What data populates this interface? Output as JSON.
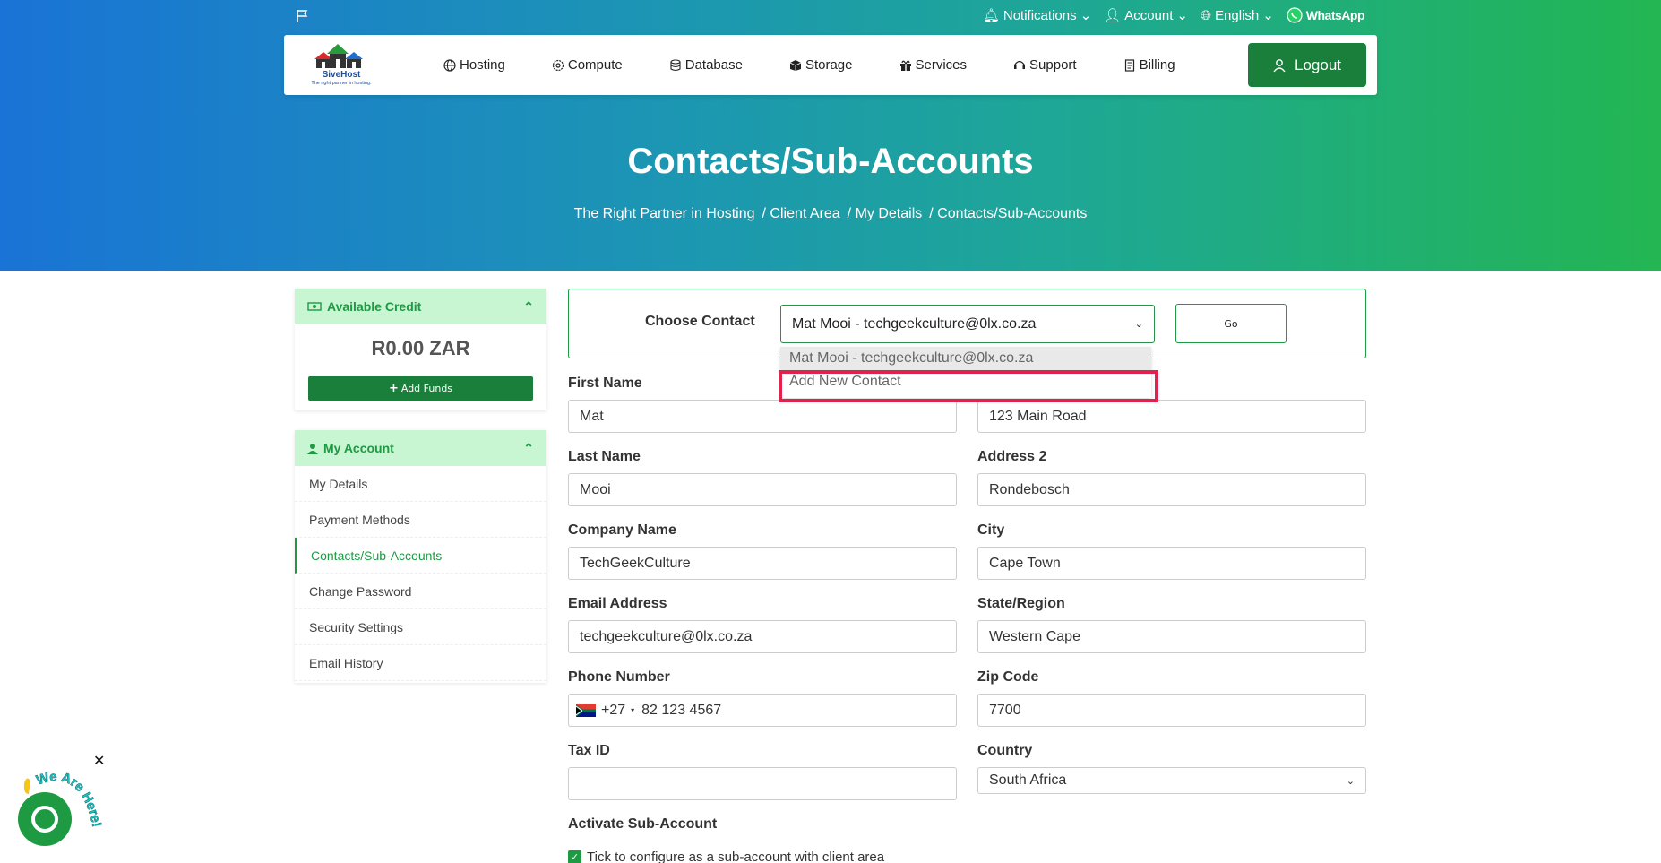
{
  "topbar": {
    "notifications": "Notifications",
    "account": "Account",
    "language": "English",
    "whatsapp": "WhatsApp"
  },
  "logo": {
    "name": "SiveHost",
    "tagline": "The right partner in hosting."
  },
  "nav": {
    "items": [
      "Hosting",
      "Compute",
      "Database",
      "Storage",
      "Services",
      "Support",
      "Billing"
    ],
    "logout": "Logout"
  },
  "page": {
    "title": "Contacts/Sub-Accounts",
    "breadcrumb": [
      "The Right Partner in Hosting",
      "/ Client Area",
      "/ My Details",
      "/ Contacts/Sub-Accounts"
    ]
  },
  "sidebar": {
    "credit": {
      "title": "Available Credit",
      "amount": "R0.00 ZAR",
      "add_funds": "Add Funds"
    },
    "account": {
      "title": "My Account",
      "items": [
        "My Details",
        "Payment Methods",
        "Contacts/Sub-Accounts",
        "Change Password",
        "Security Settings",
        "Email History"
      ]
    }
  },
  "choose": {
    "label": "Choose Contact",
    "selected": "Mat Mooi - techgeekculture@0lx.co.za",
    "options": [
      "Mat Mooi - techgeekculture@0lx.co.za",
      "Add New Contact"
    ],
    "go": "Go"
  },
  "form": {
    "first_name_label": "First Name",
    "first_name": "Mat",
    "last_name_label": "Last Name",
    "last_name": "Mooi",
    "company_label": "Company Name",
    "company": "TechGeekCulture",
    "email_label": "Email Address",
    "email": "techgeekculture@0lx.co.za",
    "phone_label": "Phone Number",
    "phone_code": "+27",
    "phone": "82 123 4567",
    "tax_label": "Tax ID",
    "tax": "",
    "address1": "123 Main Road",
    "address2_label": "Address 2",
    "address2": "Rondebosch",
    "city_label": "City",
    "city": "Cape Town",
    "state_label": "State/Region",
    "state": "Western Cape",
    "zip_label": "Zip Code",
    "zip": "7700",
    "country_label": "Country",
    "country": "South Africa",
    "subaccount_label": "Activate Sub-Account",
    "subaccount_check": "Tick to configure as a sub-account with client area"
  },
  "chat": {
    "badge": "We Are Here!"
  }
}
